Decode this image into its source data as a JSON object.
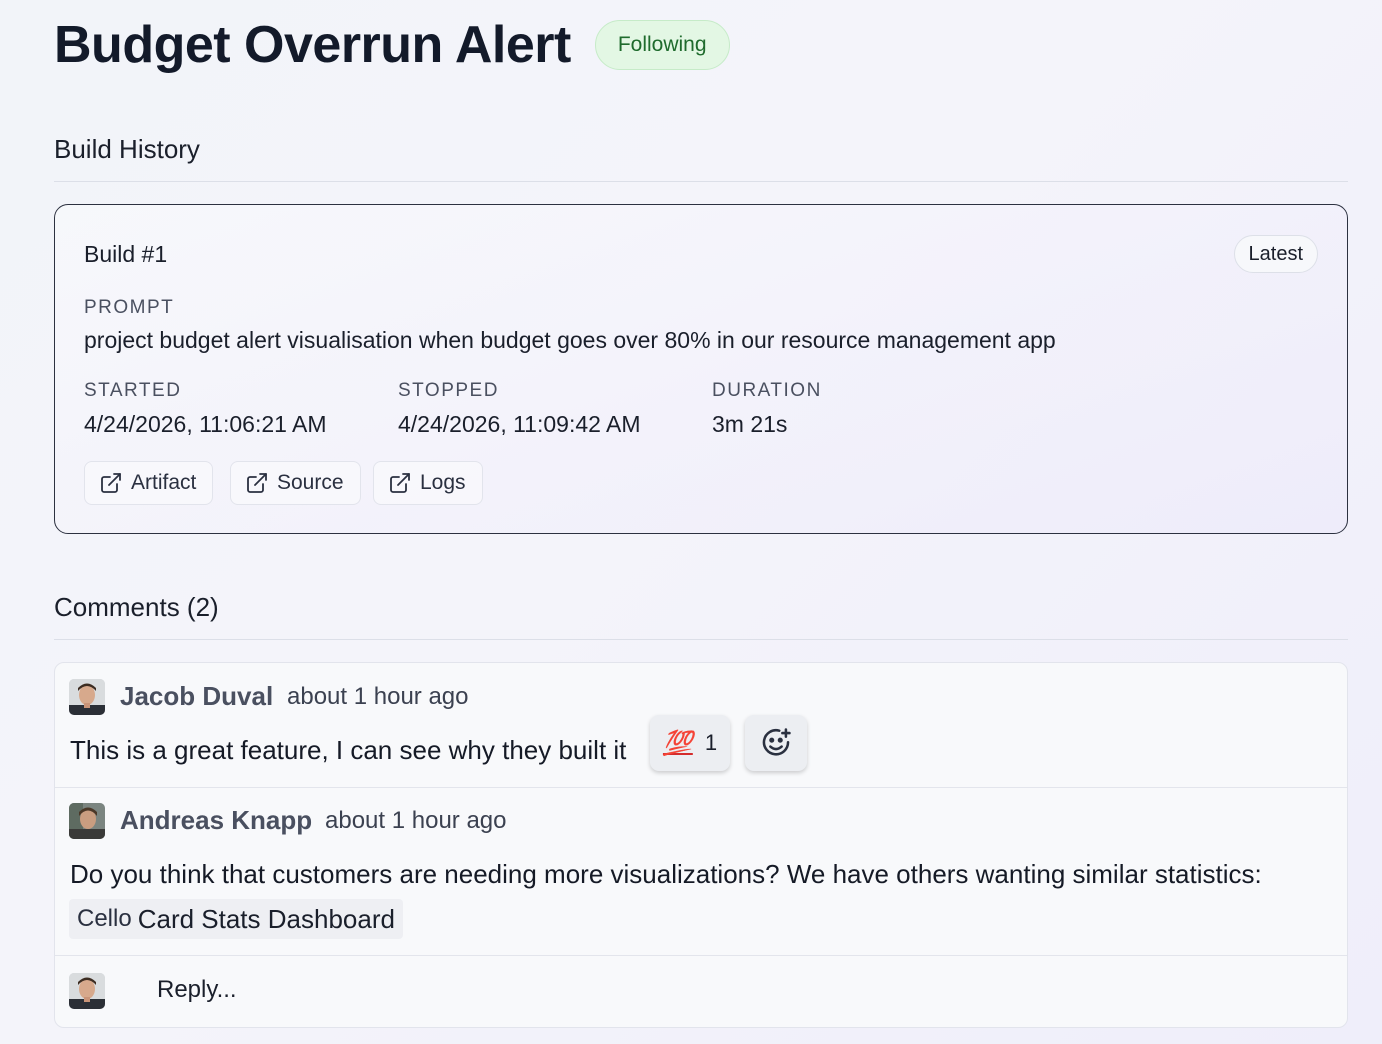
{
  "header": {
    "title": "Budget Overrun Alert",
    "follow_label": "Following"
  },
  "build_history": {
    "section_title": "Build History",
    "build": {
      "title": "Build #1",
      "badge": "Latest",
      "prompt_label": "PROMPT",
      "prompt": "project budget alert visualisation when budget goes over 80% in our resource management app",
      "started_label": "STARTED",
      "started": "4/24/2026, 11:06:21 AM",
      "stopped_label": "STOPPED",
      "stopped": "4/24/2026, 11:09:42 AM",
      "duration_label": "DURATION",
      "duration": "3m 21s",
      "links": [
        {
          "label": "Artifact",
          "icon": "external-link-icon"
        },
        {
          "label": "Source",
          "icon": "external-link-icon"
        },
        {
          "label": "Logs",
          "icon": "external-link-icon"
        }
      ]
    }
  },
  "comments": {
    "section_title": "Comments (2)",
    "items": [
      {
        "author": "Jacob Duval",
        "time": "about 1 hour ago",
        "body": "This is a great feature, I can see why they built it",
        "reaction": {
          "emoji": "💯",
          "count": "1"
        },
        "add_reaction_icon": "add-emoji-icon"
      },
      {
        "author": "Andreas Knapp",
        "time": "about 1 hour ago",
        "body": "Do you think that customers are needing more visualizations? We have others wanting similar statistics:",
        "link": {
          "brand": "Cello",
          "label": "Card Stats Dashboard"
        }
      }
    ],
    "reply_placeholder": "Reply..."
  },
  "colors": {
    "following_bg": "#e3f7e4",
    "following_text": "#1f6b2d",
    "reaction_emoji": "#d42c2c"
  }
}
